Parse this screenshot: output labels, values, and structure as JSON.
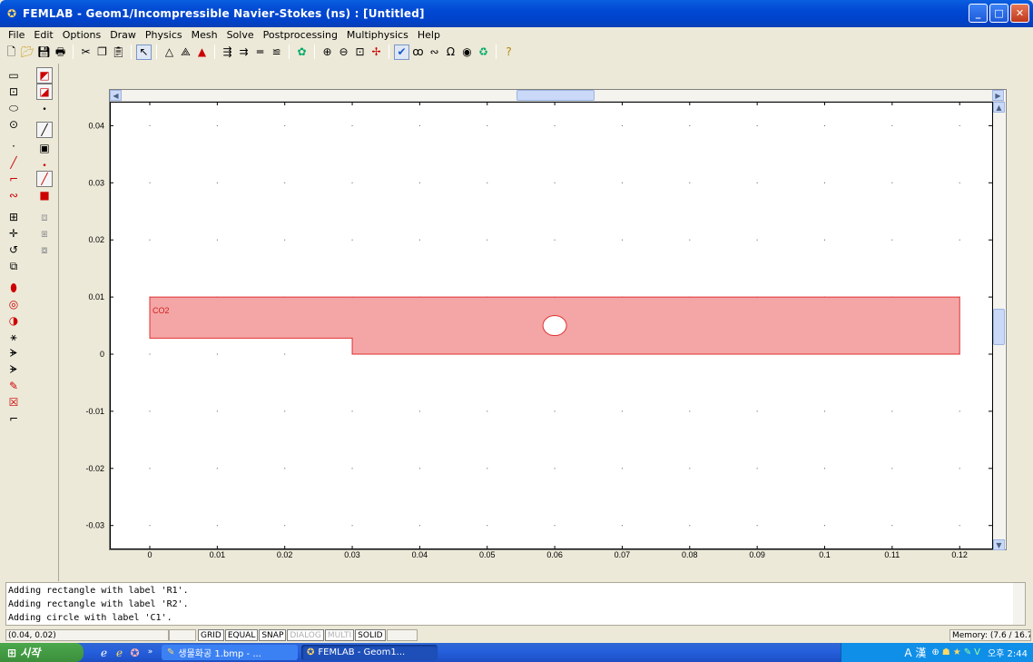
{
  "window": {
    "title": "FEMLAB - Geom1/Incompressible Navier-Stokes (ns) : [Untitled]",
    "minimize": "_",
    "maximize": "□",
    "close": "✕"
  },
  "menu": [
    "File",
    "Edit",
    "Options",
    "Draw",
    "Physics",
    "Mesh",
    "Solve",
    "Postprocessing",
    "Multiphysics",
    "Help"
  ],
  "toolbar": {
    "icons": [
      "new-file-icon",
      "open-folder-icon",
      "save-icon",
      "print-icon",
      "cut-icon",
      "copy-icon",
      "paste-icon",
      "select-arrow-icon",
      "triangle-mesh-icon",
      "refine-mesh-icon",
      "adapt-mesh-icon",
      "subdomain-settings-icon",
      "boundary-settings-icon",
      "point-settings-icon",
      "equation-icon",
      "solve-icon",
      "zoom-in-icon",
      "zoom-out-icon",
      "zoom-window-icon",
      "zoom-extents-icon",
      "plot-icon",
      "plot-param-icon",
      "animation-icon",
      "omega-icon",
      "sphere-icon",
      "restart-icon",
      "help-icon"
    ]
  },
  "left_toolbar": {
    "icons": [
      "rectangle-icon",
      "ellipse-icon",
      "centered-rectangle-icon",
      "centered-ellipse-icon",
      "point-icon",
      "line-icon",
      "arc-icon",
      "curve-icon",
      "array-icon",
      "move-icon",
      "rotate-icon",
      "scale-icon",
      "union-icon",
      "intersection-icon",
      "difference-icon",
      "compose-icon",
      "split-icon",
      "convert-icon",
      "fillet-icon",
      "delete-icon",
      "tangent-icon"
    ]
  },
  "plot": {
    "domain_label": "CO2",
    "x_ticks": [
      "0",
      "0.01",
      "0.02",
      "0.03",
      "0.04",
      "0.05",
      "0.06",
      "0.07",
      "0.08",
      "0.09",
      "0.1",
      "0.11",
      "0.12"
    ],
    "y_ticks": [
      "0.04",
      "0.03",
      "0.02",
      "0.01",
      "0",
      "-0.01",
      "-0.02",
      "-0.03"
    ],
    "fill_color": "#f4a6a6",
    "edge_color": "#e03030"
  },
  "console": {
    "lines": [
      "Adding rectangle with label 'R1'.",
      "Adding rectangle with label 'R2'.",
      "Adding circle with label 'C1'."
    ]
  },
  "status": {
    "coords": "(0.04, 0.02)",
    "flags": [
      "GRID",
      "EQUAL",
      "SNAP",
      "DIALOG",
      "MULTI",
      "SOLID"
    ],
    "memory": "Memory: (7.6 / 16.7"
  },
  "taskbar": {
    "start": "시작",
    "tasks": [
      "생물화공 1.bmp - ...",
      "FEMLAB - Geom1..."
    ],
    "tray_ime": "A 漢",
    "clock": "오후 2:44"
  }
}
